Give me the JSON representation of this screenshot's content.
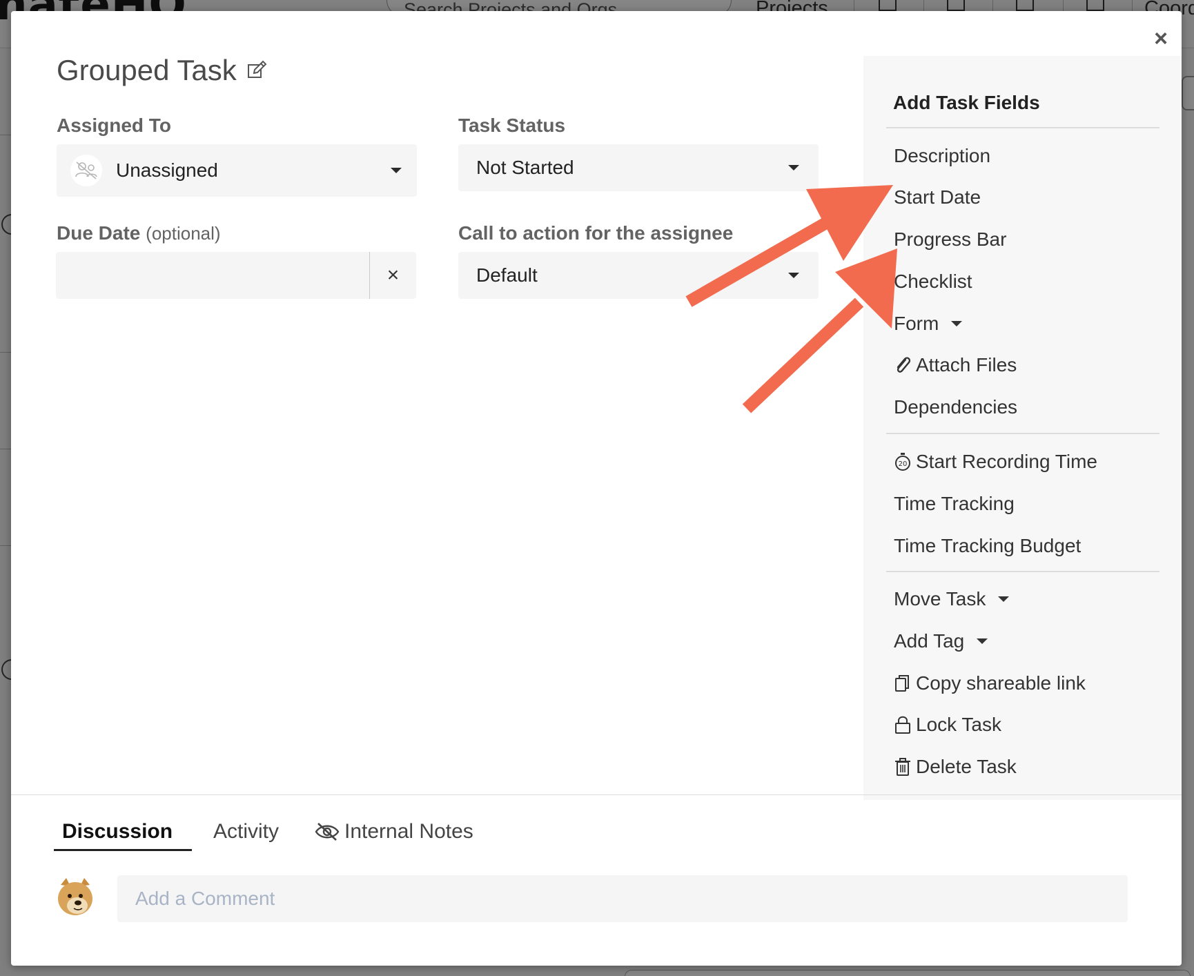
{
  "background": {
    "logo_text": "nateHQ",
    "search_placeholder": "Search Projects and Orgs",
    "nav_projects": "Projects",
    "nav_coordinate": "Coord"
  },
  "modal": {
    "title": "Grouped Task",
    "close_label": "×",
    "assigned_to": {
      "label": "Assigned To",
      "value": "Unassigned"
    },
    "task_status": {
      "label": "Task Status",
      "value": "Not Started"
    },
    "due_date": {
      "label": "Due Date",
      "optional": "(optional)",
      "value": "",
      "clear_label": "×"
    },
    "call_to_action": {
      "label": "Call to action for the assignee",
      "value": "Default"
    }
  },
  "side_panel": {
    "title": "Add Task Fields",
    "group1": [
      "Description",
      "Start Date",
      "Progress Bar",
      "Checklist",
      "Form",
      "Attach Files",
      "Dependencies"
    ],
    "group2": [
      "Start Recording Time",
      "Time Tracking",
      "Time Tracking Budget"
    ],
    "group3": [
      "Move Task",
      "Add Tag",
      "Copy shareable link",
      "Lock Task",
      "Delete Task"
    ]
  },
  "bottom": {
    "tabs": [
      "Discussion",
      "Activity",
      "Internal Notes"
    ],
    "active_tab": "Discussion",
    "comment_placeholder": "Add a Comment"
  },
  "colors": {
    "arrow": "#f26b4f",
    "overlay": "rgba(0,0,0,0.48)",
    "field_bg": "#f5f5f5",
    "panel_bg": "#f7f7f7"
  }
}
